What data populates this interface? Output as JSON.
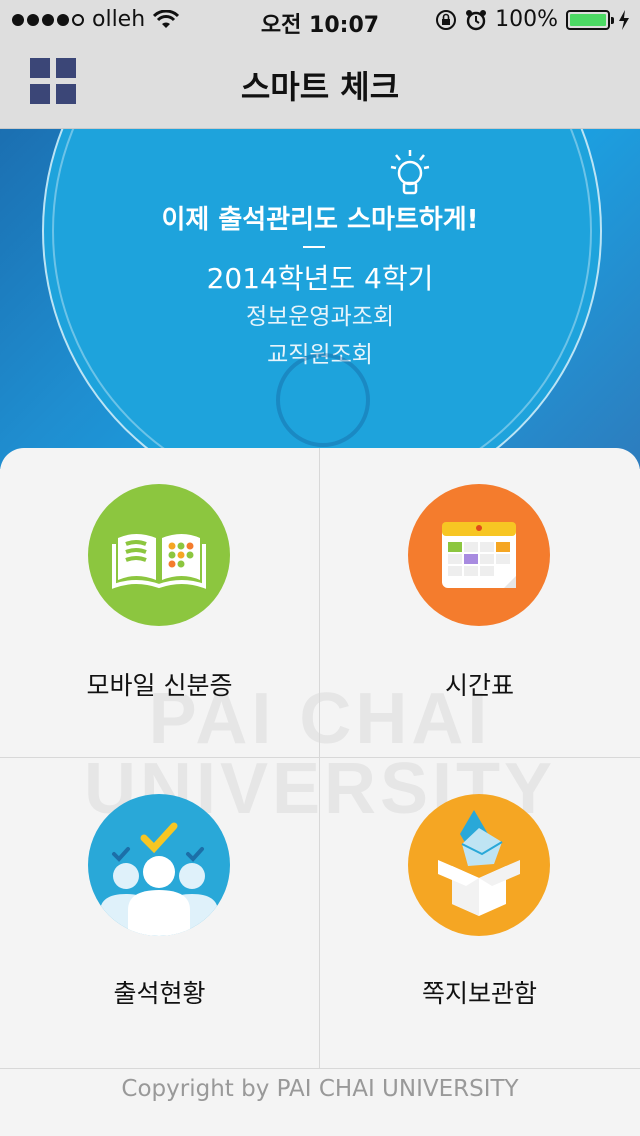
{
  "status_bar": {
    "carrier": "olleh",
    "time": "오전 10:07",
    "battery_percent": "100%",
    "signal_bars": 4,
    "icons": [
      "wifi-icon",
      "rotation-lock-icon",
      "alarm-icon",
      "battery-icon",
      "charging-icon"
    ],
    "battery_color": "#4cd964"
  },
  "nav": {
    "title": "스마트 체크",
    "menu_icon": "grid-menu-icon",
    "menu_color": "#3b4677"
  },
  "banner": {
    "slogan": "이제 출석관리도 스마트하게!",
    "term": "2014학년도 4학기",
    "link_1": "정보운영과조회",
    "link_2": "교직원조회",
    "icon": "lightbulb-icon",
    "bg_color": "#1ea3dc"
  },
  "watermark": {
    "line1": "PAI CHAI",
    "line2": "UNIVERSITY"
  },
  "tiles": [
    {
      "label": "모바일 신분증",
      "icon": "book-icon",
      "color": "#8cc63f"
    },
    {
      "label": "시간표",
      "icon": "calendar-icon",
      "color": "#f47c2d"
    },
    {
      "label": "출석현황",
      "icon": "attendance-people-icon",
      "color": "#29a8d8"
    },
    {
      "label": "쪽지보관함",
      "icon": "message-box-icon",
      "color": "#f5a623"
    }
  ],
  "footer": {
    "copyright": "Copyright by PAI CHAI UNIVERSITY"
  }
}
